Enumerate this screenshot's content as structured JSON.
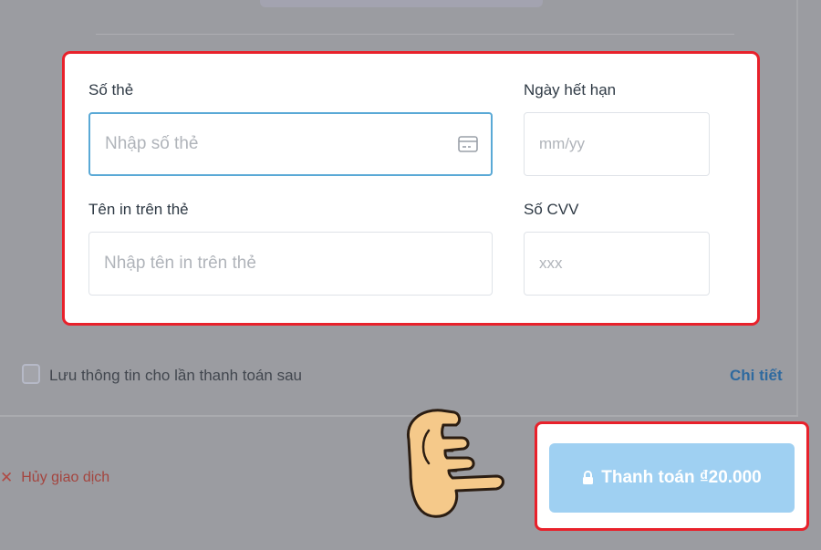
{
  "card_form": {
    "card_number": {
      "label": "Số thẻ",
      "placeholder": "Nhập số thẻ",
      "value": ""
    },
    "expiry": {
      "label": "Ngày hết hạn",
      "placeholder": "mm/yy",
      "value": ""
    },
    "cardholder": {
      "label": "Tên in trên thẻ",
      "placeholder": "Nhập tên in trên thẻ",
      "value": ""
    },
    "cvv": {
      "label": "Số CVV",
      "placeholder": "xxx",
      "value": ""
    }
  },
  "save_info": {
    "label": "Lưu thông tin cho lần thanh toán sau",
    "checked": false
  },
  "details_link": "Chi tiết",
  "cancel": {
    "label": "Hủy giao dịch"
  },
  "pay_button": {
    "label": "Thanh toán ₫20.000"
  },
  "colors": {
    "highlight_border": "#e8212b",
    "pay_button_bg": "#9fd0f2",
    "focus_border": "#5aa9d6",
    "overlay": "#9b9ca1"
  },
  "icons": [
    "credit-card-icon",
    "close-icon",
    "lock-icon",
    "pointing-hand-icon"
  ]
}
